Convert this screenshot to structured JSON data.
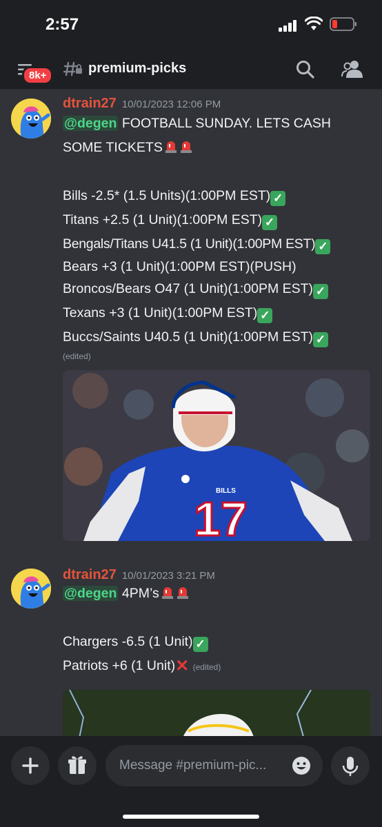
{
  "status_bar": {
    "time": "2:57"
  },
  "header": {
    "badge": "8k+",
    "channel_name": "premium-picks",
    "icons": [
      "menu-icon",
      "locked-hash-icon",
      "search-icon",
      "members-icon"
    ]
  },
  "messages": [
    {
      "username": "dtrain27",
      "timestamp": "10/01/2023 12:06 PM",
      "mention": "@degen",
      "intro_line1": "FOOTBALL SUNDAY. LETS CASH",
      "intro_line2": "SOME TICKETS",
      "picks": [
        "Bills -2.5* (1.5 Units)(1:00PM EST)",
        "Titans +2.5 (1 Unit)(1:00PM EST)",
        "Bengals/Titans U41.5 (1 Unit)(1:00PM EST)",
        "Bears +3 (1 Unit)(1:00PM EST)(PUSH)",
        "Broncos/Bears O47 (1 Unit)(1:00PM EST)",
        "Texans +3 (1 Unit)(1:00PM EST)",
        "Buccs/Saints U40.5 (1 Unit)(1:00PM EST)"
      ],
      "edited": "(edited)",
      "gif_jersey_number": "17",
      "gif_jersey_text": "BILLS"
    },
    {
      "username": "dtrain27",
      "timestamp": "10/01/2023 3:21 PM",
      "mention": "@degen",
      "intro": "4PM’s",
      "picks": [
        "Chargers -6.5 (1 Unit)",
        "Patriots +6 (1 Unit)"
      ],
      "edited": "(edited)"
    }
  ],
  "composer": {
    "placeholder": "Message #premium-pic...",
    "icons": [
      "plus-icon",
      "gift-icon",
      "emoji-icon",
      "mic-icon"
    ]
  },
  "colors": {
    "background": "#313338",
    "header": "#1e1f22",
    "username": "#e5533c",
    "mention": "#4fd68a",
    "badge": "#f23f43"
  }
}
